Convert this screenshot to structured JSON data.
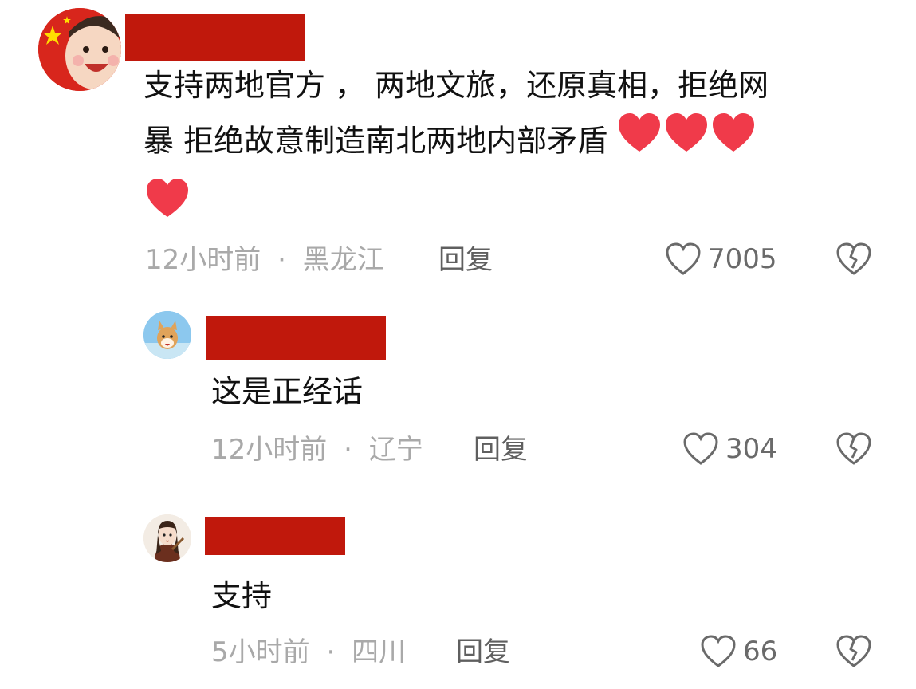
{
  "comments": [
    {
      "avatar": "flag-child-avatar",
      "text_line1": "支持两地官方 ， 两地文旅，还原真相，拒绝网",
      "text_line2": "暴 拒绝故意制造南北两地内部矛盾",
      "emoji": "red-heart",
      "time": "12小时前",
      "sep": "·",
      "location": "黑龙江",
      "reply_label": "回复",
      "likes": "7005"
    },
    {
      "avatar": "shiba-dog-avatar",
      "text": "这是正经话",
      "time": "12小时前",
      "sep": "·",
      "location": "辽宁",
      "reply_label": "回复",
      "likes": "304"
    },
    {
      "avatar": "anime-girl-avatar",
      "text": "支持",
      "time": "5小时前",
      "sep": "·",
      "location": "四川",
      "reply_label": "回复",
      "likes": "66"
    }
  ],
  "colors": {
    "redaction": "#c0180c",
    "heart": "#f03a4a",
    "meta": "#a9a9a9"
  }
}
